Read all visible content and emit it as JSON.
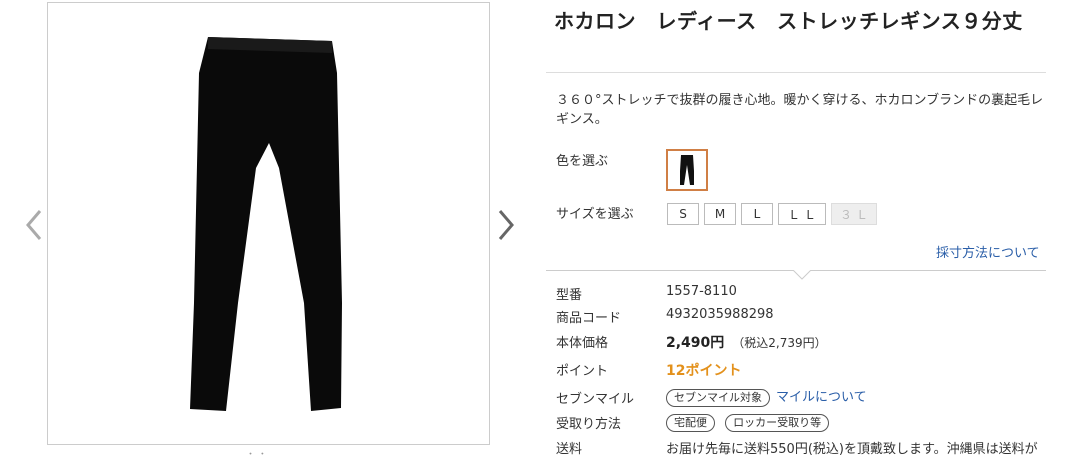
{
  "product": {
    "title": "ホカロン　レディース　ストレッチレギンス９分丈",
    "description": "３６０°ストレッチで抜群の履き心地。暖かく穿ける、ホカロンブランドの裏起毛レギンス。"
  },
  "gallery": {
    "main_image_icon": "black-leggings-image",
    "prev_icon": "chevron-left-icon",
    "next_icon": "chevron-right-icon",
    "hint_text": "・ ・"
  },
  "options": {
    "color_label": "色を選ぶ",
    "colors": [
      "black"
    ],
    "size_label": "サイズを選ぶ",
    "sizes": [
      {
        "label": "S",
        "available": true
      },
      {
        "label": "M",
        "available": true
      },
      {
        "label": "L",
        "available": true
      },
      {
        "label": "ＬＬ",
        "available": true
      },
      {
        "label": "３Ｌ",
        "available": false
      }
    ],
    "measure_link": "採寸方法について"
  },
  "specs": {
    "model_label": "型番",
    "model_value": "1557-8110",
    "code_label": "商品コード",
    "code_value": "4932035988298",
    "price_label": "本体価格",
    "price_value": "2,490円",
    "price_tax": "（税込2,739円）",
    "point_label": "ポイント",
    "point_value": "12ポイント",
    "mile_label": "セブンマイル",
    "mile_badge": "セブンマイル対象",
    "mile_link": "マイルについて",
    "receive_label": "受取り方法",
    "receive_option1": "宅配便",
    "receive_option2": "ロッカー受取り等",
    "shipping_label": "送料",
    "shipping_value": "お届け先毎に送料550円(税込)を頂戴致します。沖縄県は送料が"
  },
  "colors": {
    "accent": "#d07f45",
    "link": "#2a5ea8",
    "points": "#e3911c"
  }
}
